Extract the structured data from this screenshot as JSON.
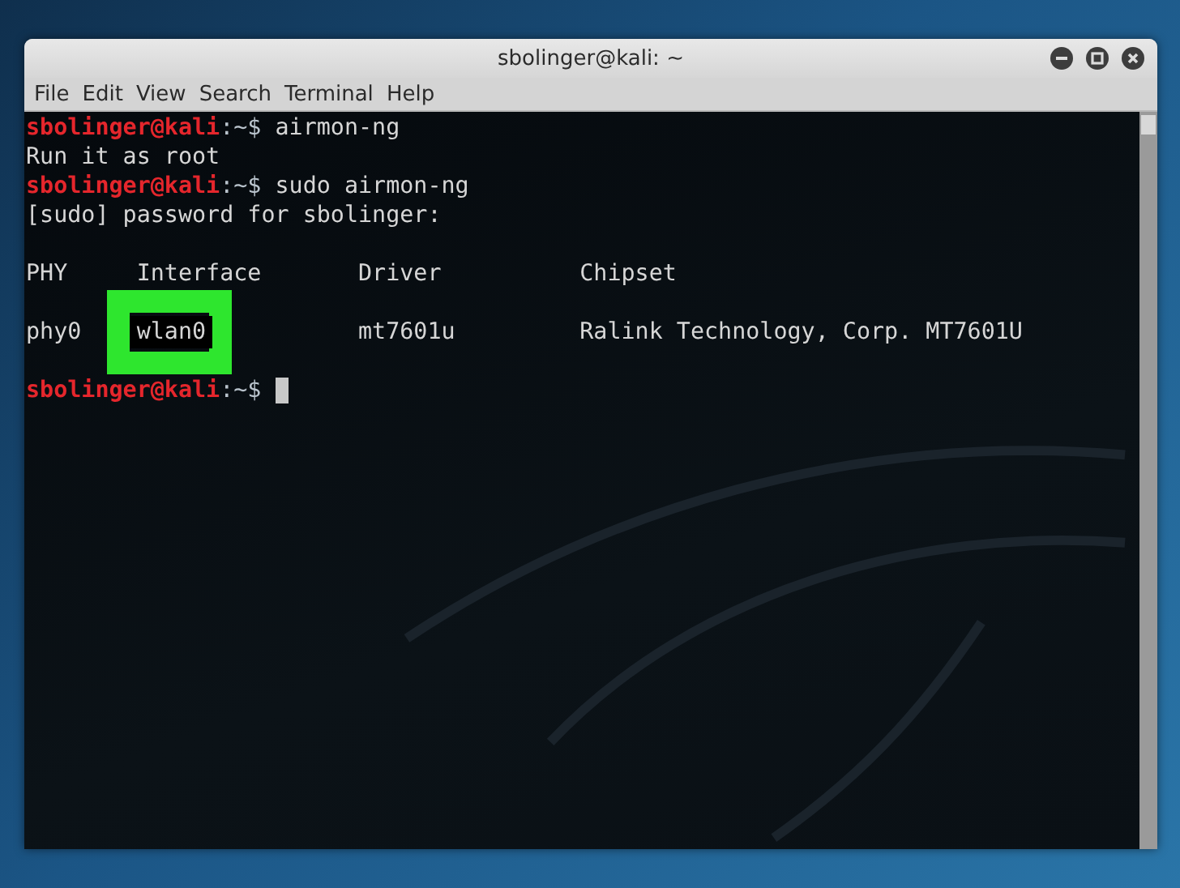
{
  "window": {
    "title": "sbolinger@kali: ~"
  },
  "menu": [
    "File",
    "Edit",
    "View",
    "Search",
    "Terminal",
    "Help"
  ],
  "terminal": {
    "lines": [
      {
        "kind": "prompt",
        "user": "sbolinger@kali",
        "suffix": ":~$",
        "command": "airmon-ng"
      },
      {
        "kind": "output",
        "text": "Run it as root"
      },
      {
        "kind": "prompt",
        "user": "sbolinger@kali",
        "suffix": ":~$",
        "command": "sudo airmon-ng"
      },
      {
        "kind": "output",
        "text": "[sudo] password for sbolinger:"
      },
      {
        "kind": "blank"
      },
      {
        "kind": "table_header",
        "cells": [
          "PHY",
          "Interface",
          "Driver",
          "Chipset"
        ]
      },
      {
        "kind": "blank"
      },
      {
        "kind": "table_row",
        "cells": [
          {
            "text": "phy0",
            "highlighted": false
          },
          {
            "text": "wlan0",
            "highlighted": true
          },
          {
            "text": "mt7601u",
            "highlighted": false
          },
          {
            "text": "Ralink Technology, Corp. MT7601U",
            "highlighted": false
          }
        ]
      },
      {
        "kind": "blank"
      },
      {
        "kind": "prompt",
        "user": "sbolinger@kali",
        "suffix": ":~$",
        "cursor": true
      }
    ]
  }
}
